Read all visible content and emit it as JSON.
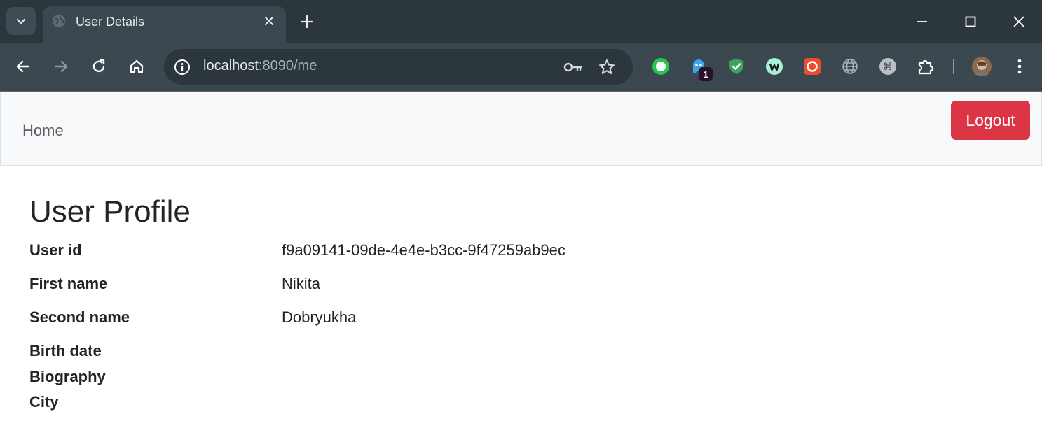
{
  "browser": {
    "tab": {
      "title": "User Details"
    },
    "address": {
      "host": "localhost",
      "rest": ":8090/me"
    },
    "extensions": [
      {
        "name": "green-circle-extension"
      },
      {
        "name": "ghost-extension",
        "badge": "1"
      },
      {
        "name": "shield-check-extension"
      },
      {
        "name": "w-extension"
      },
      {
        "name": "red-ring-extension"
      },
      {
        "name": "globe-extension"
      },
      {
        "name": "command-extension"
      }
    ],
    "colors": {
      "frame": "#2b363d",
      "toolbar": "#3b4850"
    }
  },
  "navbar": {
    "home_label": "Home",
    "logout_label": "Logout"
  },
  "profile": {
    "title": "User Profile",
    "fields": [
      {
        "label": "User id",
        "value": "f9a09141-09de-4e4e-b3cc-9f47259ab9ec"
      },
      {
        "label": "First name",
        "value": "Nikita"
      },
      {
        "label": "Second name",
        "value": "Dobryukha"
      },
      {
        "label": "Birth date",
        "value": ""
      },
      {
        "label": "Biography",
        "value": ""
      },
      {
        "label": "City",
        "value": ""
      }
    ]
  },
  "colors": {
    "danger": "#dc3545",
    "navbar_bg": "#f8f9fa",
    "text": "#212529"
  }
}
